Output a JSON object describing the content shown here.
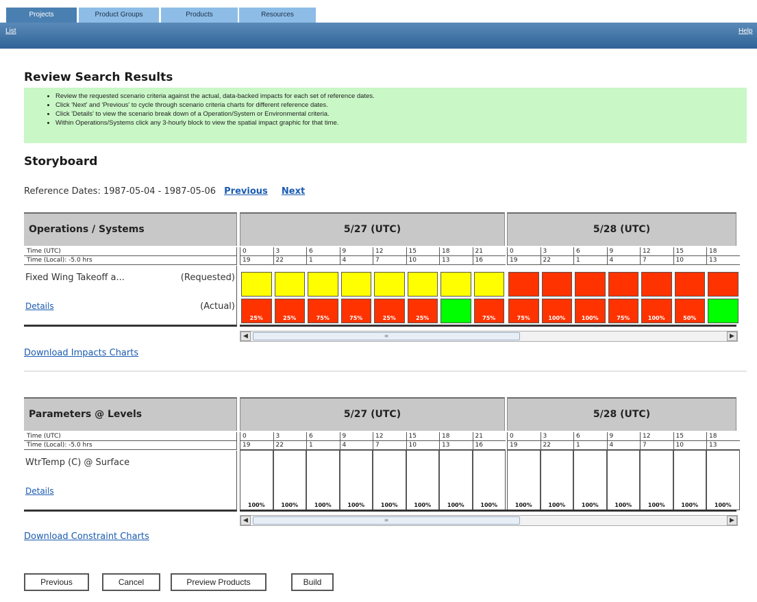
{
  "tabs": [
    "Projects",
    "Product Groups",
    "Products",
    "Resources"
  ],
  "subnav": {
    "list": "List",
    "help": "Help"
  },
  "title": "Review Search Results",
  "instructions": [
    "Review the requested scenario criteria against the actual, data-backed impacts for each set of reference dates.",
    "Click 'Next' and 'Previous' to cycle through scenario criteria charts for different reference dates.",
    "Click 'Details' to view the scenario break down of a Operation/System or Environmental criteria.",
    "Within Operations/Systems click any 3-hourly block to view the spatial impact graphic for that time."
  ],
  "storyboard_title": "Storyboard",
  "reference": {
    "label": "Reference Dates: 1987-05-04 - 1987-05-06",
    "previous": "Previous",
    "next": "Next"
  },
  "ops": {
    "header": "Operations / Systems",
    "days": [
      "5/27 (UTC)",
      "5/28 (UTC)"
    ],
    "time_utc_label": "Time (UTC)",
    "time_local_label": "Time (Local): -5.0 hrs",
    "row_name": "Fixed Wing Takeoff a...",
    "requested_label": "(Requested)",
    "actual_label": "(Actual)",
    "details": "Details",
    "download": "Download Impacts Charts"
  },
  "params": {
    "header": "Parameters @ Levels",
    "days": [
      "5/27 (UTC)",
      "5/28 (UTC)"
    ],
    "time_utc_label": "Time (UTC)",
    "time_local_label": "Time (Local): -5.0 hrs",
    "row_name": "WtrTemp (C) @ Surface",
    "details": "Details",
    "download": "Download Constraint Charts"
  },
  "utc_hours": [
    [
      "0",
      "3",
      "6",
      "9",
      "12",
      "15",
      "18",
      "21"
    ],
    [
      "0",
      "3",
      "6",
      "9",
      "12",
      "15",
      "18"
    ]
  ],
  "local_hours": [
    [
      "19",
      "22",
      "1",
      "4",
      "7",
      "10",
      "13",
      "16"
    ],
    [
      "19",
      "22",
      "1",
      "4",
      "7",
      "10",
      "13"
    ]
  ],
  "requested_colors": [
    [
      "yellow",
      "yellow",
      "yellow",
      "yellow",
      "yellow",
      "yellow",
      "yellow",
      "yellow"
    ],
    [
      "red",
      "red",
      "red",
      "red",
      "red",
      "red",
      "red"
    ]
  ],
  "actual": [
    [
      {
        "c": "red",
        "p": "25%"
      },
      {
        "c": "red",
        "p": "25%"
      },
      {
        "c": "red",
        "p": "75%"
      },
      {
        "c": "red",
        "p": "75%"
      },
      {
        "c": "red",
        "p": "25%"
      },
      {
        "c": "red",
        "p": "25%"
      },
      {
        "c": "green",
        "p": ""
      },
      {
        "c": "red",
        "p": "75%"
      }
    ],
    [
      {
        "c": "red",
        "p": "75%"
      },
      {
        "c": "red",
        "p": "100%"
      },
      {
        "c": "red",
        "p": "100%"
      },
      {
        "c": "red",
        "p": "75%"
      },
      {
        "c": "red",
        "p": "100%"
      },
      {
        "c": "red",
        "p": "50%"
      },
      {
        "c": "green",
        "p": ""
      }
    ]
  ],
  "param_values": [
    [
      "100%",
      "100%",
      "100%",
      "100%",
      "100%",
      "100%",
      "100%",
      "100%"
    ],
    [
      "100%",
      "100%",
      "100%",
      "100%",
      "100%",
      "100%",
      "100%"
    ]
  ],
  "buttons": {
    "previous": "Previous",
    "cancel": "Cancel",
    "preview": "Preview Products",
    "build": "Build"
  },
  "colors": {
    "yellow": "#ffff00",
    "red": "#ff3300",
    "green": "#00ff00",
    "tab_active": "#4a7fb1",
    "tab_inactive": "#8dbde6",
    "info_bg": "#c9f7c6"
  }
}
